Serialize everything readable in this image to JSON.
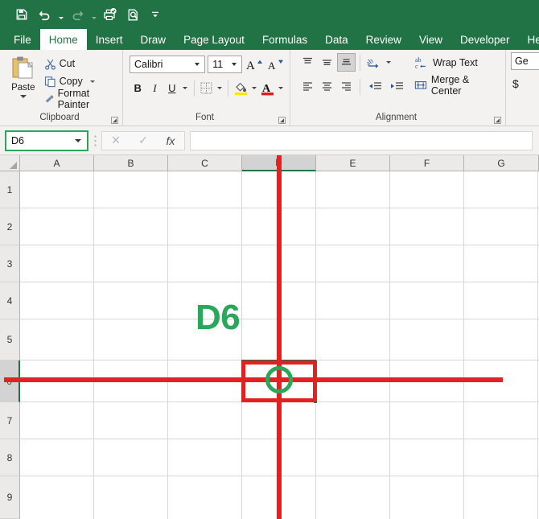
{
  "quick_access": {
    "items": [
      {
        "name": "save-icon",
        "label": "Save",
        "enabled": true,
        "caret": false
      },
      {
        "name": "undo-icon",
        "label": "Undo",
        "enabled": true,
        "caret": true
      },
      {
        "name": "redo-icon",
        "label": "Redo",
        "enabled": false,
        "caret": true
      },
      {
        "name": "print-approve-icon",
        "label": "Quick Print",
        "enabled": true,
        "caret": false
      },
      {
        "name": "print-preview-icon",
        "label": "Print Preview and Print",
        "enabled": true,
        "caret": false
      },
      {
        "name": "customize-qat-icon",
        "label": "Customize Quick Access Toolbar",
        "enabled": true,
        "caret": false
      }
    ]
  },
  "ribbon": {
    "tabs": [
      {
        "label": "File",
        "active": false
      },
      {
        "label": "Home",
        "active": true
      },
      {
        "label": "Insert",
        "active": false
      },
      {
        "label": "Draw",
        "active": false
      },
      {
        "label": "Page Layout",
        "active": false
      },
      {
        "label": "Formulas",
        "active": false
      },
      {
        "label": "Data",
        "active": false
      },
      {
        "label": "Review",
        "active": false
      },
      {
        "label": "View",
        "active": false
      },
      {
        "label": "Developer",
        "active": false
      },
      {
        "label": "He",
        "active": false
      }
    ],
    "clipboard": {
      "group_label": "Clipboard",
      "paste_label": "Paste",
      "cut_label": "Cut",
      "copy_label": "Copy",
      "format_painter_label": "Format Painter"
    },
    "font": {
      "group_label": "Font",
      "font_name": "Calibri",
      "font_size": "11",
      "grow_font_label": "A",
      "shrink_font_label": "A",
      "bold_label": "B",
      "italic_label": "I",
      "underline_label": "U"
    },
    "alignment": {
      "group_label": "Alignment",
      "wrap_text_label": "Wrap Text",
      "merge_center_label": "Merge & Center",
      "wrap_icon_label": "ab",
      "wrap_icon_sub": "c"
    },
    "number": {
      "format_value": "Ge",
      "currency_label": "$"
    }
  },
  "formula_bar": {
    "name_box_value": "D6",
    "cancel_label": "✕",
    "enter_label": "✓",
    "fx_label": "fx",
    "formula_value": "",
    "formula_placeholder": ""
  },
  "sheet": {
    "columns": [
      {
        "label": "A",
        "selected": false
      },
      {
        "label": "B",
        "selected": false
      },
      {
        "label": "C",
        "selected": false
      },
      {
        "label": "D",
        "selected": true
      },
      {
        "label": "E",
        "selected": false
      },
      {
        "label": "F",
        "selected": false
      },
      {
        "label": "G",
        "selected": false
      }
    ],
    "rows": [
      {
        "label": "1",
        "selected": false
      },
      {
        "label": "2",
        "selected": false
      },
      {
        "label": "3",
        "selected": false
      },
      {
        "label": "4",
        "selected": false
      },
      {
        "label": "5",
        "selected": false
      },
      {
        "label": "6",
        "selected": true
      },
      {
        "label": "7",
        "selected": false
      },
      {
        "label": "8",
        "selected": false
      },
      {
        "label": "9",
        "selected": false
      }
    ],
    "active_cell": "D6"
  },
  "annotation": {
    "label": "D6",
    "label_color": "#2aa75a",
    "crosshair_color": "#e02222",
    "circle_color": "#2aa75a"
  },
  "colors": {
    "brand_green": "#217346",
    "accent_green": "#2aa75a",
    "ribbon_bg": "#f3f2f1",
    "header_bg": "#eceae8",
    "selected_header_bg": "#d3d3d3",
    "gridline": "#d7d7d7"
  }
}
